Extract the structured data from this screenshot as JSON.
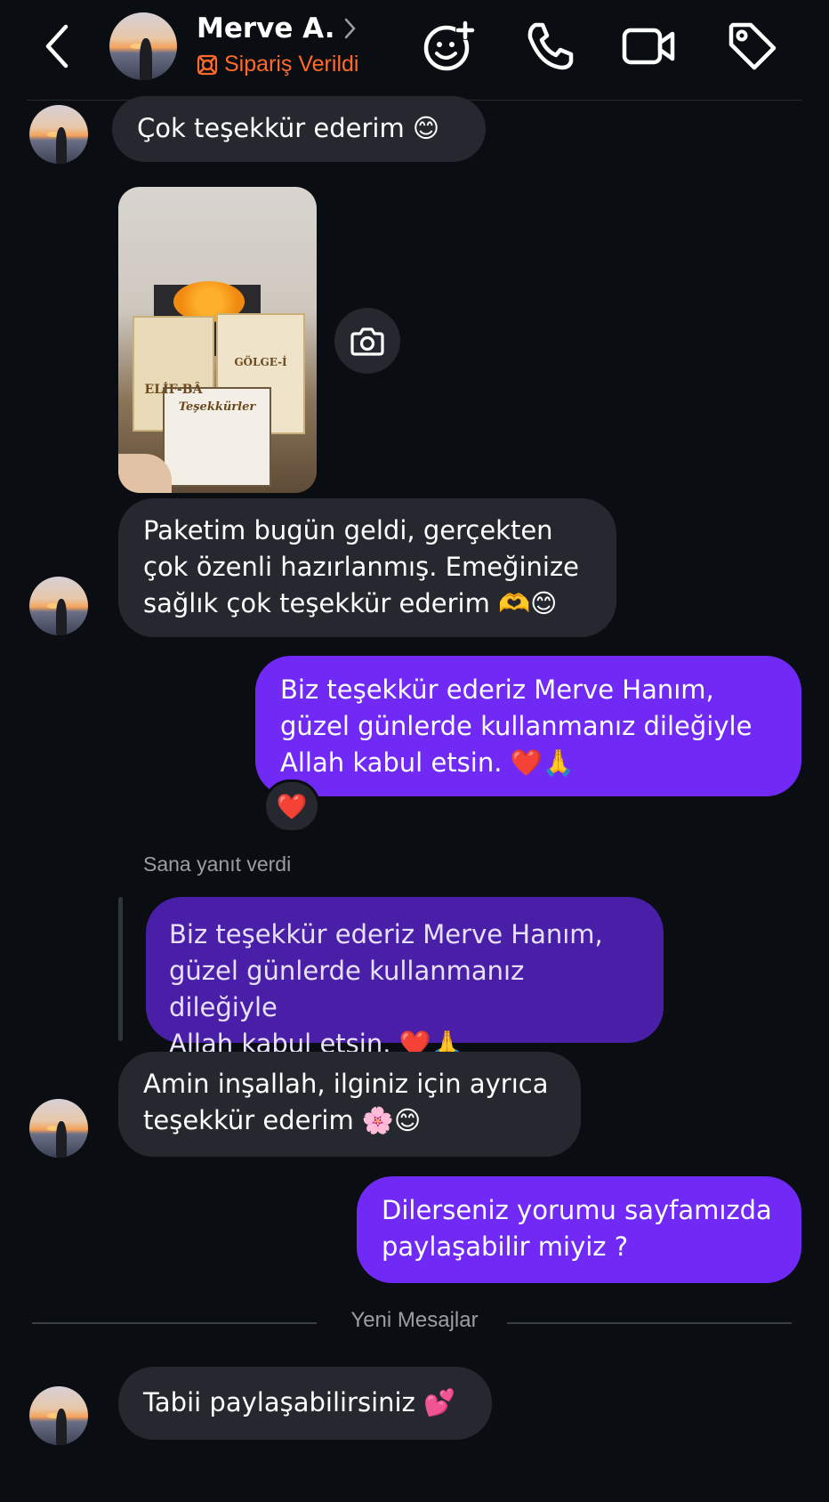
{
  "header": {
    "contact_name": "Merve A.",
    "status_text": "Sipariş Verildi",
    "icons": [
      "back-arrow-icon",
      "emoji-add-icon",
      "phone-icon",
      "video-icon",
      "tag-icon"
    ],
    "status_color": "#ff6a2b"
  },
  "messages": [
    {
      "id": "m1",
      "direction": "incoming",
      "text": "Çok teşekkür ederim 😊"
    },
    {
      "id": "m2",
      "direction": "incoming",
      "type": "photo",
      "photo_text": [
        "ELİF-BÂ",
        "GÖLGE-İ",
        "Teşekkürler"
      ]
    },
    {
      "id": "m3",
      "direction": "incoming",
      "text": "Paketim bugün geldi, gerçekten\nçok özenli hazırlanmış. Emeğinize\nsağlık çok teşekkür ederim 🫶😊"
    },
    {
      "id": "m4",
      "direction": "outgoing",
      "text": "Biz teşekkür ederiz Merve Hanım,\ngüzel günlerde kullanmanız dileğiyle\nAllah kabul etsin. ❤️🙏",
      "reaction": "❤️"
    },
    {
      "id": "m5",
      "direction": "incoming",
      "reply_label": "Sana yanıt verdi",
      "quoted_text": "Biz teşekkür ederiz Merve Hanım,\ngüzel günlerde kullanmanız dileğiyle\nAllah kabul etsin. ❤️🙏"
    },
    {
      "id": "m6",
      "direction": "incoming",
      "text": "Amin inşallah, ilginiz için ayrıca\nteşekkür ederim 🌸😊"
    },
    {
      "id": "m7",
      "direction": "outgoing",
      "text": "Dilerseniz yorumu sayfamızda\npaylaşabilir miyiz ?"
    },
    {
      "id": "m8",
      "direction": "incoming",
      "text": "Tabii paylaşabilirsiniz 💕"
    }
  ],
  "separator": {
    "text": "Yeni Mesajlar"
  },
  "colors": {
    "background": "#0a0d12",
    "incoming_bubble": "#25282e",
    "outgoing_bubble": "#7129f5",
    "quoted_bubble": "#4a1fa8"
  }
}
